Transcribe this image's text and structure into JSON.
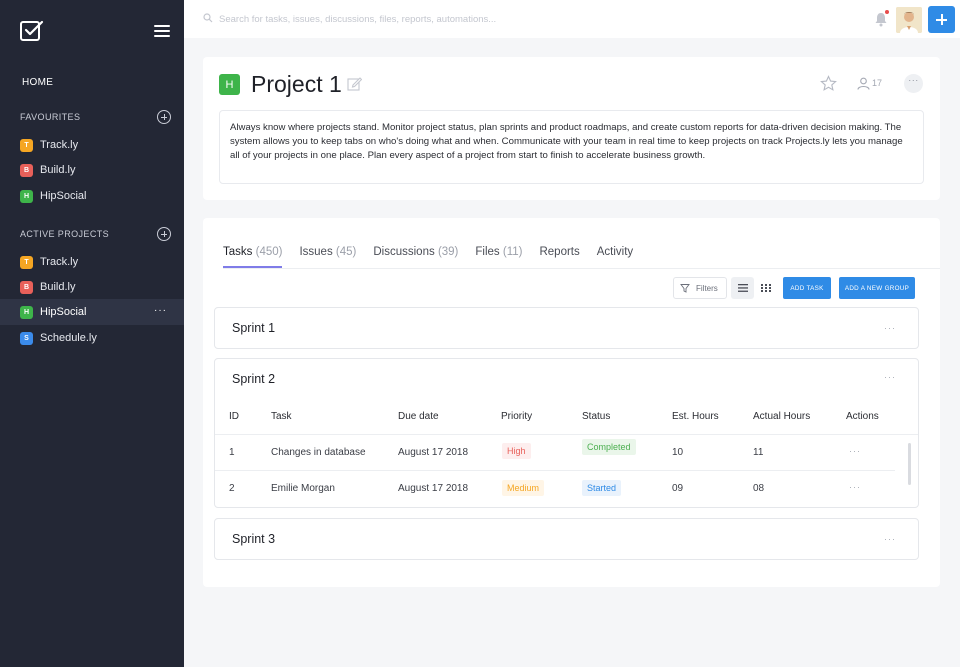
{
  "sidebar": {
    "home": "HOME",
    "favourites_title": "FAVOURITES",
    "favourites": [
      {
        "letter": "T",
        "label": "Track.ly",
        "color": "#f5a623"
      },
      {
        "letter": "B",
        "label": "Build.ly",
        "color": "#e8605a"
      },
      {
        "letter": "H",
        "label": "HipSocial",
        "color": "#3eb44a"
      }
    ],
    "active_title": "ACTIVE PROJECTS",
    "active": [
      {
        "letter": "T",
        "label": "Track.ly",
        "color": "#f5a623"
      },
      {
        "letter": "B",
        "label": "Build.ly",
        "color": "#e8605a"
      },
      {
        "letter": "H",
        "label": "HipSocial",
        "color": "#3eb44a"
      },
      {
        "letter": "S",
        "label": "Schedule.ly",
        "color": "#3b8beb"
      }
    ],
    "active_dots": "···"
  },
  "topbar": {
    "search_placeholder": "Search for tasks, issues, discussions, files, reports, automations..."
  },
  "project": {
    "badge": "H",
    "title": "Project 1",
    "member_count": "17",
    "more": "···",
    "description": "Always know where projects stand. Monitor project status, plan sprints and product roadmaps, and create custom reports for data-driven decision making. The system allows you to keep tabs on who's doing what and when. Communicate with your team in real time to keep projects on track Projects.ly lets you manage all of your projects in one place. Plan every aspect of a project from start to finish to accelerate business growth."
  },
  "tabs": [
    {
      "label": "Tasks",
      "count": "(450)"
    },
    {
      "label": "Issues",
      "count": "(45)"
    },
    {
      "label": "Discussions",
      "count": "(39)"
    },
    {
      "label": "Files",
      "count": "(11)"
    },
    {
      "label": "Reports",
      "count": ""
    },
    {
      "label": "Activity",
      "count": ""
    }
  ],
  "toolbar": {
    "filters": "Filters",
    "add_task": "ADD TASK",
    "add_group": "ADD A NEW GROUP"
  },
  "sprints": {
    "s1": "Sprint 1",
    "s2": "Sprint 2",
    "s3": "Sprint 3",
    "dots": "···"
  },
  "table": {
    "headers": [
      "ID",
      "Task",
      "Due date",
      "Priority",
      "Status",
      "Est. Hours",
      "Actual Hours",
      "Actions"
    ],
    "rows": [
      {
        "id": "1",
        "task": "Changes in database",
        "due": "August 17 2018",
        "priority": "High",
        "status": "Completed",
        "est": "10",
        "actual": "11",
        "actions": "···"
      },
      {
        "id": "2",
        "task": "Emilie Morgan",
        "due": "August 17 2018",
        "priority": "Medium",
        "status": "Started",
        "est": "09",
        "actual": "08",
        "actions": "···"
      }
    ]
  },
  "colors": {
    "accent": "#2f8be6",
    "tab_underline": "#7f7ce8",
    "high": "#e8605a",
    "medium": "#f5a623",
    "completed": "#4caf50",
    "started": "#2f8be6"
  }
}
